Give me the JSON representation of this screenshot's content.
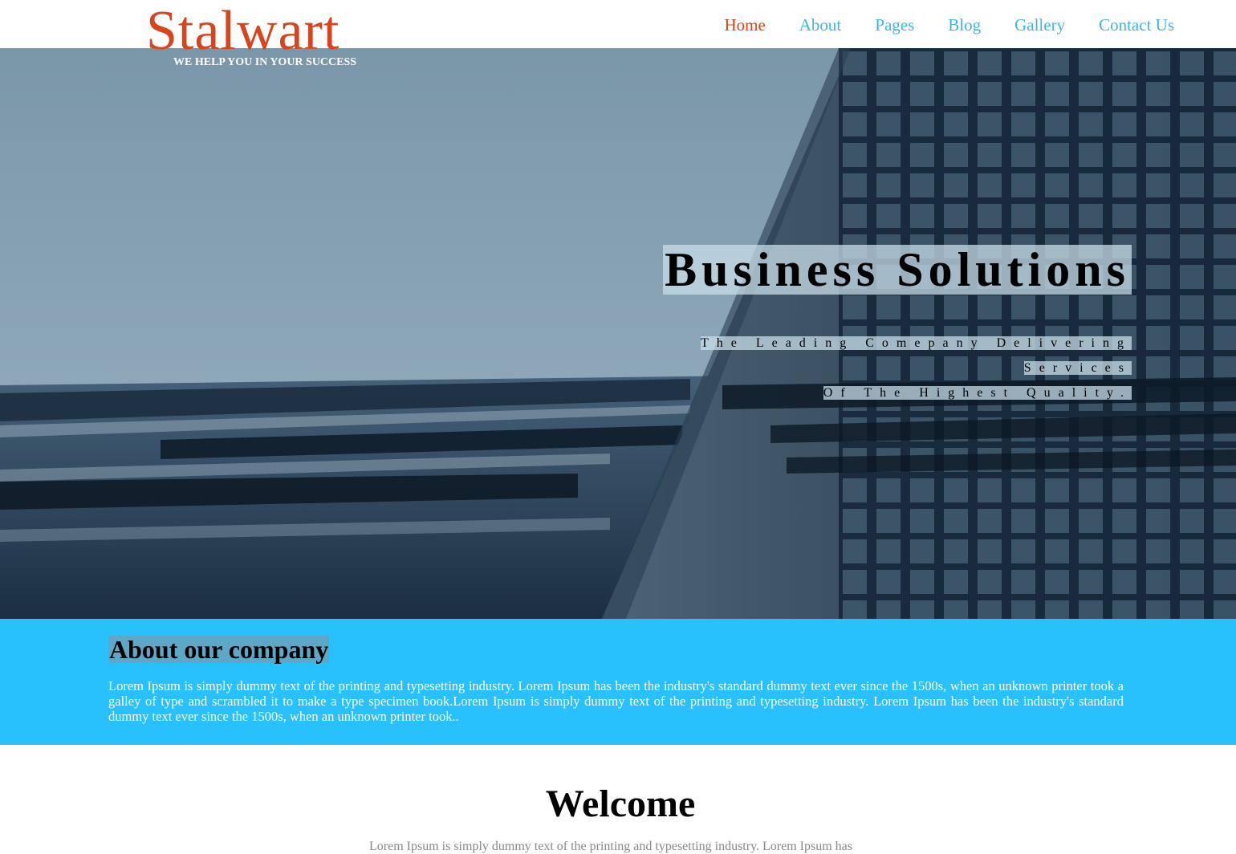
{
  "brand": {
    "name": "Stalwart",
    "tagline": "WE HELP YOU IN YOUR SUCCESS",
    "accent_color": "#d8441c"
  },
  "nav": {
    "items": [
      {
        "label": "Home",
        "active": true
      },
      {
        "label": "About",
        "active": false
      },
      {
        "label": "Pages",
        "active": false
      },
      {
        "label": "Blog",
        "active": false
      },
      {
        "label": "Gallery",
        "active": false
      },
      {
        "label": "Contact Us",
        "active": false
      }
    ],
    "link_color": "#3fb4e8"
  },
  "hero": {
    "title": "Business Solutions",
    "subtitle_line1": "The Leading Comepany Delivering Services",
    "subtitle_line2": "Of The Highest Quality."
  },
  "about": {
    "title": "About our company",
    "text": "Lorem Ipsum is simply dummy text of the printing and typesetting industry. Lorem Ipsum has been the industry's standard dummy text ever since the 1500s, when an unknown printer took a galley of type and scrambled it to make a type specimen book.Lorem Ipsum is simply dummy text of the printing and typesetting industry. Lorem Ipsum has been the industry's standard dummy text ever since the 1500s, when an unknown printer took..",
    "background_color": "#29c1fd"
  },
  "welcome": {
    "title": "Welcome",
    "text": "Lorem Ipsum is simply dummy text of the printing and typesetting industry. Lorem Ipsum has"
  }
}
